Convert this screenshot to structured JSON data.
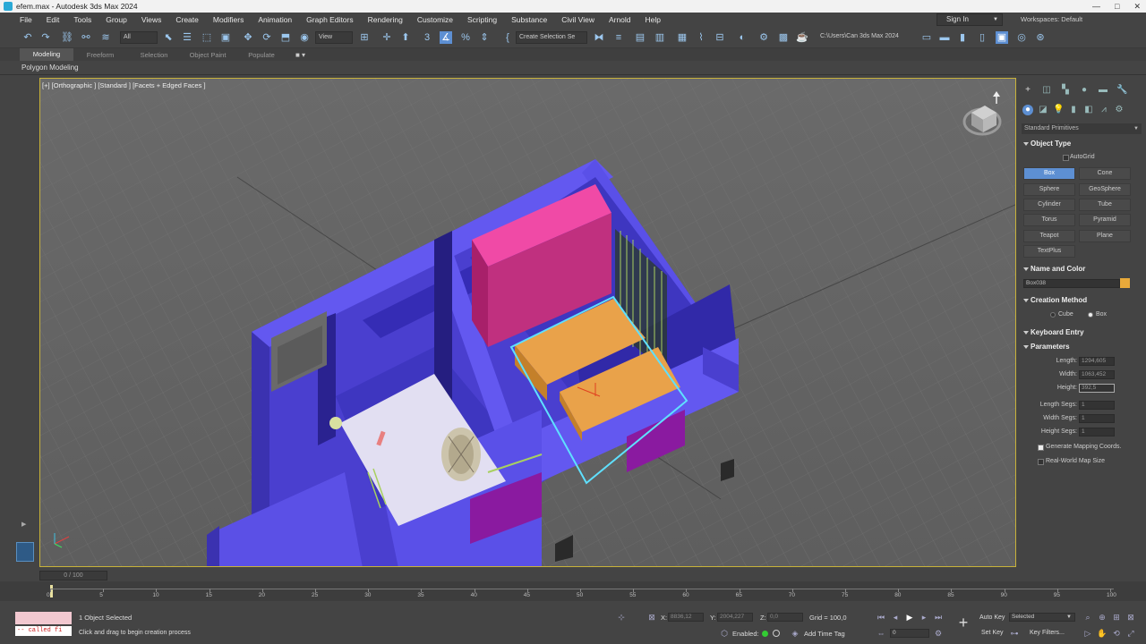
{
  "window": {
    "title": "efem.max - Autodesk 3ds Max 2024",
    "controls": [
      "—",
      "□",
      "✕"
    ]
  },
  "menu": {
    "items": [
      "File",
      "Edit",
      "Tools",
      "Group",
      "Views",
      "Create",
      "Modifiers",
      "Animation",
      "Graph Editors",
      "Rendering",
      "Customize",
      "Scripting",
      "Substance",
      "Civil View",
      "Arnold",
      "Help"
    ],
    "sign_in": "Sign In",
    "workspaces": "Workspaces: Default"
  },
  "toolbar": {
    "filter_select": "All",
    "ref_coord": "View",
    "named_selection": "Create Selection Se",
    "path": "C:\\Users\\Can 3ds Max 2024"
  },
  "ribbon": {
    "tabs": [
      "Modeling",
      "Freeform",
      "Selection",
      "Object Paint",
      "Populate"
    ],
    "active_tab": "Modeling",
    "sub_label": "Polygon Modeling"
  },
  "viewport": {
    "label": "[+] [Orthographic ] [Standard ] [Facets + Edged Faces ]",
    "colors": {
      "walls": "#5b50e6",
      "magenta_block": "#e0409a",
      "orange_box": "#e8a040",
      "floor": "#e0def0",
      "selection": "#5fe0ff"
    }
  },
  "command_panel": {
    "category": "Standard Primitives",
    "object_type": {
      "title": "Object Type",
      "autogrid": "AutoGrid",
      "buttons": [
        "Box",
        "Cone",
        "Sphere",
        "GeoSphere",
        "Cylinder",
        "Tube",
        "Torus",
        "Pyramid",
        "Teapot",
        "Plane",
        "TextPlus"
      ],
      "selected": "Box"
    },
    "name_color": {
      "title": "Name and Color",
      "name": "Box038",
      "color": "#e8a93a"
    },
    "creation_method": {
      "title": "Creation Method",
      "options": [
        "Cube",
        "Box"
      ],
      "selected": "Box"
    },
    "keyboard_entry": "Keyboard Entry",
    "parameters": {
      "title": "Parameters",
      "length_label": "Length:",
      "length": "1294,605",
      "width_label": "Width:",
      "width": "1063,452",
      "height_label": "Height:",
      "height": "392,5",
      "length_segs_label": "Length Segs:",
      "length_segs": "1",
      "width_segs_label": "Width Segs:",
      "width_segs": "1",
      "height_segs_label": "Height Segs:",
      "height_segs": "1",
      "gen_mapping": "Generate Mapping Coords.",
      "real_world": "Real-World Map Size"
    }
  },
  "timeline": {
    "slider": "0 / 100",
    "ticks": [
      "0",
      "5",
      "10",
      "15",
      "20",
      "25",
      "30",
      "35",
      "40",
      "45",
      "50",
      "55",
      "60",
      "65",
      "70",
      "75",
      "80",
      "85",
      "90",
      "95",
      "100"
    ]
  },
  "status": {
    "maxscript": "-- called fi",
    "selected": "1 Object Selected",
    "prompt": "Click and drag to begin creation process",
    "x_label": "X:",
    "x": "8836,12",
    "y_label": "Y:",
    "y": "2004,227",
    "z_label": "Z:",
    "z": "0,0",
    "grid": "Grid = 100,0",
    "enabled": "Enabled:",
    "add_time_tag": "Add Time Tag",
    "frame": "0",
    "auto_key": "Auto Key",
    "set_key": "Set Key",
    "key_mode": "Selected",
    "key_filters": "Key Filters..."
  }
}
